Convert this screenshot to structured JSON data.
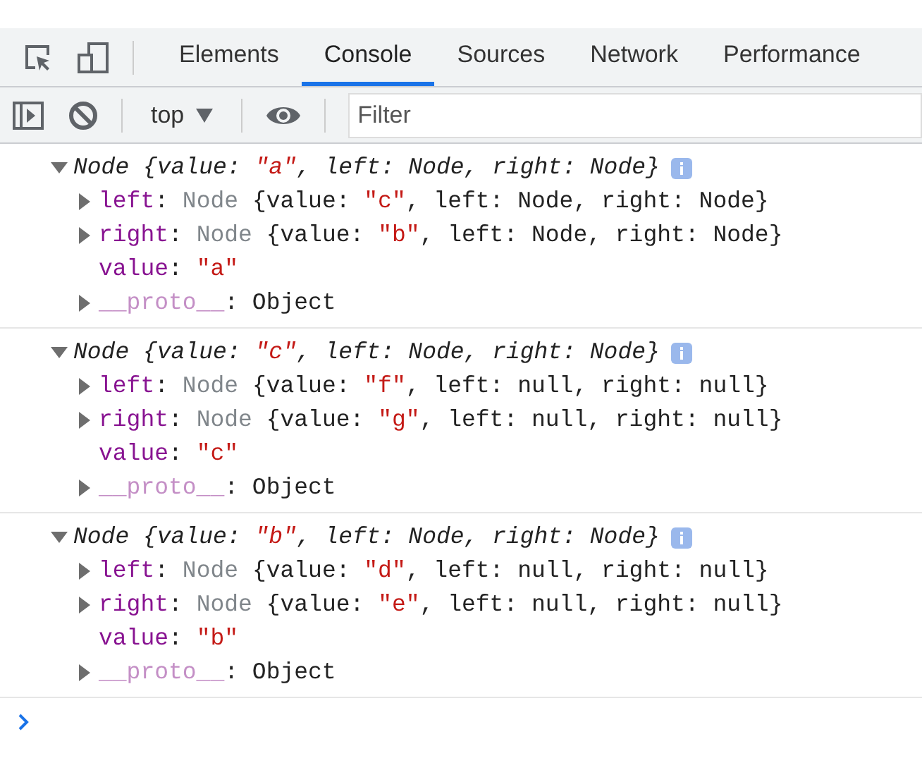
{
  "tabs": [
    {
      "label": "Elements",
      "selected": false
    },
    {
      "label": "Console",
      "selected": true
    },
    {
      "label": "Sources",
      "selected": false
    },
    {
      "label": "Network",
      "selected": false
    },
    {
      "label": "Performance",
      "selected": false
    }
  ],
  "toolbar": {
    "context": "top",
    "filter": {
      "placeholder": "Filter"
    }
  },
  "entries": [
    {
      "expanded": true,
      "summary": [
        {
          "text": "Node {value: ",
          "kind": "plain"
        },
        {
          "text": "\"a\"",
          "kind": "string"
        },
        {
          "text": ", left: Node, right: Node}",
          "kind": "plain"
        }
      ],
      "properties": [
        {
          "kind": "object",
          "expanded": false,
          "segments": [
            {
              "text": "left",
              "kind": "key"
            },
            {
              "text": ": ",
              "kind": "plain"
            },
            {
              "text": "Node ",
              "kind": "faded"
            },
            {
              "text": "{value: ",
              "kind": "plain"
            },
            {
              "text": "\"c\"",
              "kind": "string"
            },
            {
              "text": ", left: Node, right: Node}",
              "kind": "plain"
            }
          ]
        },
        {
          "kind": "object",
          "expanded": false,
          "segments": [
            {
              "text": "right",
              "kind": "key"
            },
            {
              "text": ": ",
              "kind": "plain"
            },
            {
              "text": "Node ",
              "kind": "faded"
            },
            {
              "text": "{value: ",
              "kind": "plain"
            },
            {
              "text": "\"b\"",
              "kind": "string"
            },
            {
              "text": ", left: Node, right: Node}",
              "kind": "plain"
            }
          ]
        },
        {
          "kind": "primitive",
          "segments": [
            {
              "text": "value",
              "kind": "key"
            },
            {
              "text": ": ",
              "kind": "plain"
            },
            {
              "text": "\"a\"",
              "kind": "string"
            }
          ]
        },
        {
          "kind": "object",
          "expanded": false,
          "segments": [
            {
              "text": "__proto__",
              "kind": "faded-key"
            },
            {
              "text": ": Object",
              "kind": "plain"
            }
          ]
        }
      ]
    },
    {
      "expanded": true,
      "summary": [
        {
          "text": "Node {value: ",
          "kind": "plain"
        },
        {
          "text": "\"c\"",
          "kind": "string"
        },
        {
          "text": ", left: Node, right: Node}",
          "kind": "plain"
        }
      ],
      "properties": [
        {
          "kind": "object",
          "expanded": false,
          "segments": [
            {
              "text": "left",
              "kind": "key"
            },
            {
              "text": ": ",
              "kind": "plain"
            },
            {
              "text": "Node ",
              "kind": "faded"
            },
            {
              "text": "{value: ",
              "kind": "plain"
            },
            {
              "text": "\"f\"",
              "kind": "string"
            },
            {
              "text": ", left: null, right: null}",
              "kind": "plain"
            }
          ]
        },
        {
          "kind": "object",
          "expanded": false,
          "segments": [
            {
              "text": "right",
              "kind": "key"
            },
            {
              "text": ": ",
              "kind": "plain"
            },
            {
              "text": "Node ",
              "kind": "faded"
            },
            {
              "text": "{value: ",
              "kind": "plain"
            },
            {
              "text": "\"g\"",
              "kind": "string"
            },
            {
              "text": ", left: null, right: null}",
              "kind": "plain"
            }
          ]
        },
        {
          "kind": "primitive",
          "segments": [
            {
              "text": "value",
              "kind": "key"
            },
            {
              "text": ": ",
              "kind": "plain"
            },
            {
              "text": "\"c\"",
              "kind": "string"
            }
          ]
        },
        {
          "kind": "object",
          "expanded": false,
          "segments": [
            {
              "text": "__proto__",
              "kind": "faded-key"
            },
            {
              "text": ": Object",
              "kind": "plain"
            }
          ]
        }
      ]
    },
    {
      "expanded": true,
      "summary": [
        {
          "text": "Node {value: ",
          "kind": "plain"
        },
        {
          "text": "\"b\"",
          "kind": "string"
        },
        {
          "text": ", left: Node, right: Node}",
          "kind": "plain"
        }
      ],
      "properties": [
        {
          "kind": "object",
          "expanded": false,
          "segments": [
            {
              "text": "left",
              "kind": "key"
            },
            {
              "text": ": ",
              "kind": "plain"
            },
            {
              "text": "Node ",
              "kind": "faded"
            },
            {
              "text": "{value: ",
              "kind": "plain"
            },
            {
              "text": "\"d\"",
              "kind": "string"
            },
            {
              "text": ", left: null, right: null}",
              "kind": "plain"
            }
          ]
        },
        {
          "kind": "object",
          "expanded": false,
          "segments": [
            {
              "text": "right",
              "kind": "key"
            },
            {
              "text": ": ",
              "kind": "plain"
            },
            {
              "text": "Node ",
              "kind": "faded"
            },
            {
              "text": "{value: ",
              "kind": "plain"
            },
            {
              "text": "\"e\"",
              "kind": "string"
            },
            {
              "text": ", left: null, right: null}",
              "kind": "plain"
            }
          ]
        },
        {
          "kind": "primitive",
          "segments": [
            {
              "text": "value",
              "kind": "key"
            },
            {
              "text": ": ",
              "kind": "plain"
            },
            {
              "text": "\"b\"",
              "kind": "string"
            }
          ]
        },
        {
          "kind": "object",
          "expanded": false,
          "segments": [
            {
              "text": "__proto__",
              "kind": "faded-key"
            },
            {
              "text": ": Object",
              "kind": "plain"
            }
          ]
        }
      ]
    }
  ]
}
